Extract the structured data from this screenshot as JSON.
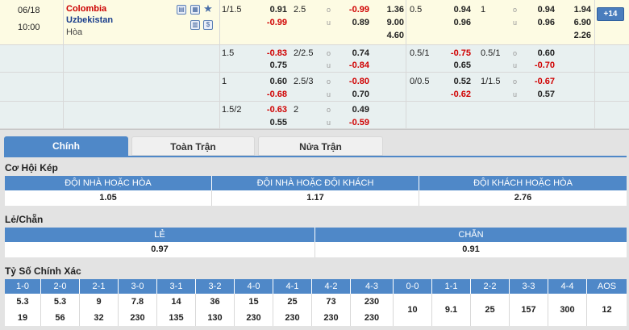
{
  "match": {
    "date": "06/18",
    "time": "10:00",
    "home": "Colombia",
    "away": "Uzbekistan",
    "draw_label": "Hòa",
    "more_label": "14"
  },
  "odds": {
    "r0": {
      "h1": "1/1.5",
      "h1a": "0.91",
      "h1b": "-0.99",
      "t1": "2.5",
      "t1a": "-0.99",
      "t1b": "0.89",
      "x1": "1.36",
      "x2": "9.00",
      "x3": "4.60",
      "h2": "0.5",
      "h2a": "0.94",
      "h2b": "0.96",
      "t2": "1",
      "t2a": "0.94",
      "t2b": "0.96",
      "y1": "1.94",
      "y2": "6.90",
      "y3": "2.26"
    },
    "r1": {
      "h1": "1.5",
      "h1a": "-0.83",
      "h1b": "0.75",
      "t1": "2/2.5",
      "t1a": "0.74",
      "t1b": "-0.84",
      "h2": "0.5/1",
      "h2a": "-0.75",
      "h2b": "0.65",
      "t2": "0.5/1",
      "t2a": "0.60",
      "t2b": "-0.70"
    },
    "r2": {
      "h1": "1",
      "h1a": "0.60",
      "h1b": "-0.68",
      "t1": "2.5/3",
      "t1a": "-0.80",
      "t1b": "0.70",
      "h2": "0/0.5",
      "h2a": "0.52",
      "h2b": "-0.62",
      "t2": "1/1.5",
      "t2a": "-0.67",
      "t2b": "0.57"
    },
    "r3": {
      "h1": "1.5/2",
      "h1a": "-0.63",
      "h1b": "0.55",
      "t1": "2",
      "t1a": "0.49",
      "t1b": "-0.59"
    },
    "o_label": "o",
    "u_label": "u"
  },
  "tabs": [
    "Chính",
    "Toàn Trận",
    "Nửa Trận"
  ],
  "double_chance": {
    "title": "Cơ Hội Kép",
    "headers": [
      "ĐỘI NHÀ HOẶC HÒA",
      "ĐỘI NHÀ HOẶC ĐỘI KHÁCH",
      "ĐỘI KHÁCH HOẶC HÒA"
    ],
    "values": [
      "1.05",
      "1.17",
      "2.76"
    ]
  },
  "odd_even": {
    "title": "Lẻ/Chẵn",
    "headers": [
      "LẺ",
      "CHẴN"
    ],
    "values": [
      "0.97",
      "0.91"
    ]
  },
  "correct_score": {
    "title": "Tỷ Số Chính Xác",
    "headers": [
      "1-0",
      "2-0",
      "2-1",
      "3-0",
      "3-1",
      "3-2",
      "4-0",
      "4-1",
      "4-2",
      "4-3",
      "0-0",
      "1-1",
      "2-2",
      "3-3",
      "4-4",
      "AOS"
    ],
    "row1": [
      "5.3",
      "5.3",
      "9",
      "7.8",
      "14",
      "36",
      "15",
      "25",
      "73",
      "230"
    ],
    "row2": [
      "19",
      "56",
      "32",
      "230",
      "135",
      "130",
      "230",
      "230",
      "230",
      "230"
    ],
    "single": [
      "10",
      "9.1",
      "25",
      "157",
      "300",
      "12"
    ]
  },
  "colors": {
    "accent": "#4f88c8",
    "negative": "#d00000",
    "home": "#cc0000",
    "away": "#1a3e8c"
  }
}
